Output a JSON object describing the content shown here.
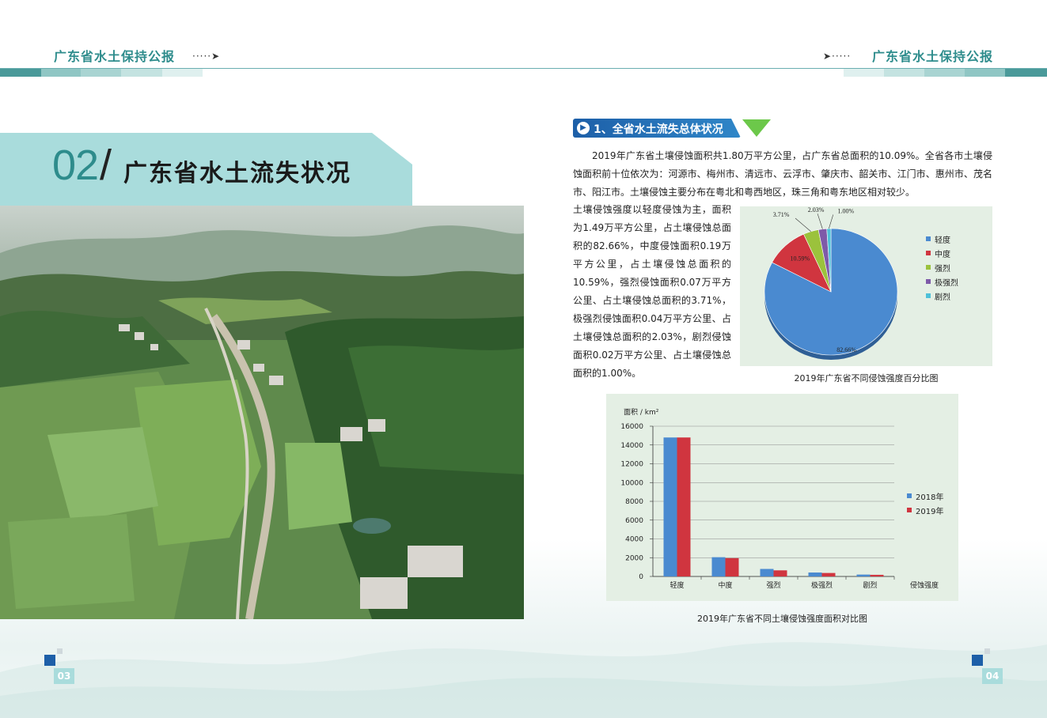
{
  "header": {
    "title": "广东省水土保持公报",
    "left_arrow": "·····➤",
    "right_arrow": "➤·····"
  },
  "section": {
    "number": "02",
    "slash": "/",
    "title": "广东省水土流失状况"
  },
  "subsection": {
    "icon": "play-circle-icon",
    "title": "1、全省水土流失总体状况"
  },
  "paragraph_main": "2019年广东省土壤侵蚀面积共1.80万平方公里，占广东省总面积的10.09%。全省各市土壤侵蚀面积前十位依次为：河源市、梅州市、清远市、云浮市、肇庆市、韶关市、江门市、惠州市、茂名市、阳江市。土壤侵蚀主要分布在粤北和粤西地区，珠三角和粤东地区相对较少。",
  "paragraph_side": "土壤侵蚀强度以轻度侵蚀为主，面积为1.49万平方公里，占土壤侵蚀总面积的82.66%，中度侵蚀面积0.19万平方公里，占土壤侵蚀总面积的10.59%，强烈侵蚀面积0.07万平方公里、占土壤侵蚀总面积的3.71%，极强烈侵蚀面积0.04万平方公里、占土壤侵蚀总面积的2.03%，剧烈侵蚀面积0.02万平方公里、占土壤侵蚀总面积的1.00%。",
  "pie_caption": "2019年广东省不同侵蚀强度百分比图",
  "bar_caption": "2019年广东省不同土壤侵蚀强度面积对比图",
  "pages": {
    "left": "03",
    "right": "04"
  },
  "colors": {
    "teal": "#2e8c8c",
    "banner": "#a9dcdc",
    "blue": "#4a8ad0",
    "red": "#d0353f",
    "green": "#9bc23c",
    "purple": "#7e5aa8",
    "cyan": "#4ec0d8"
  },
  "chart_data": [
    {
      "type": "pie",
      "title": "2019年广东省不同侵蚀强度百分比图",
      "categories": [
        "轻度",
        "中度",
        "强烈",
        "极强烈",
        "剧烈"
      ],
      "values": [
        82.66,
        10.59,
        3.71,
        2.03,
        1.0
      ],
      "labels": [
        "82.66%",
        "10.59%",
        "3.71%",
        "2.03%",
        "1.00%"
      ],
      "colors": [
        "#4a8ad0",
        "#d0353f",
        "#9bc23c",
        "#7e5aa8",
        "#4ec0d8"
      ],
      "legend": "right"
    },
    {
      "type": "bar",
      "title": "2019年广东省不同土壤侵蚀强度面积对比图",
      "categories": [
        "轻度",
        "中度",
        "强烈",
        "极强烈",
        "剧烈"
      ],
      "series": [
        {
          "name": "2018年",
          "values": [
            14800,
            2050,
            800,
            420,
            200
          ],
          "color": "#4a8ad0"
        },
        {
          "name": "2019年",
          "values": [
            14800,
            1950,
            650,
            370,
            175
          ],
          "color": "#d0353f"
        }
      ],
      "ylabel": "面积 / km²",
      "xlabel": "侵蚀强度",
      "ylim": [
        0,
        16000
      ],
      "yticks": [
        0,
        2000,
        4000,
        6000,
        8000,
        10000,
        12000,
        14000,
        16000
      ],
      "grid": true,
      "legend": "right"
    }
  ]
}
